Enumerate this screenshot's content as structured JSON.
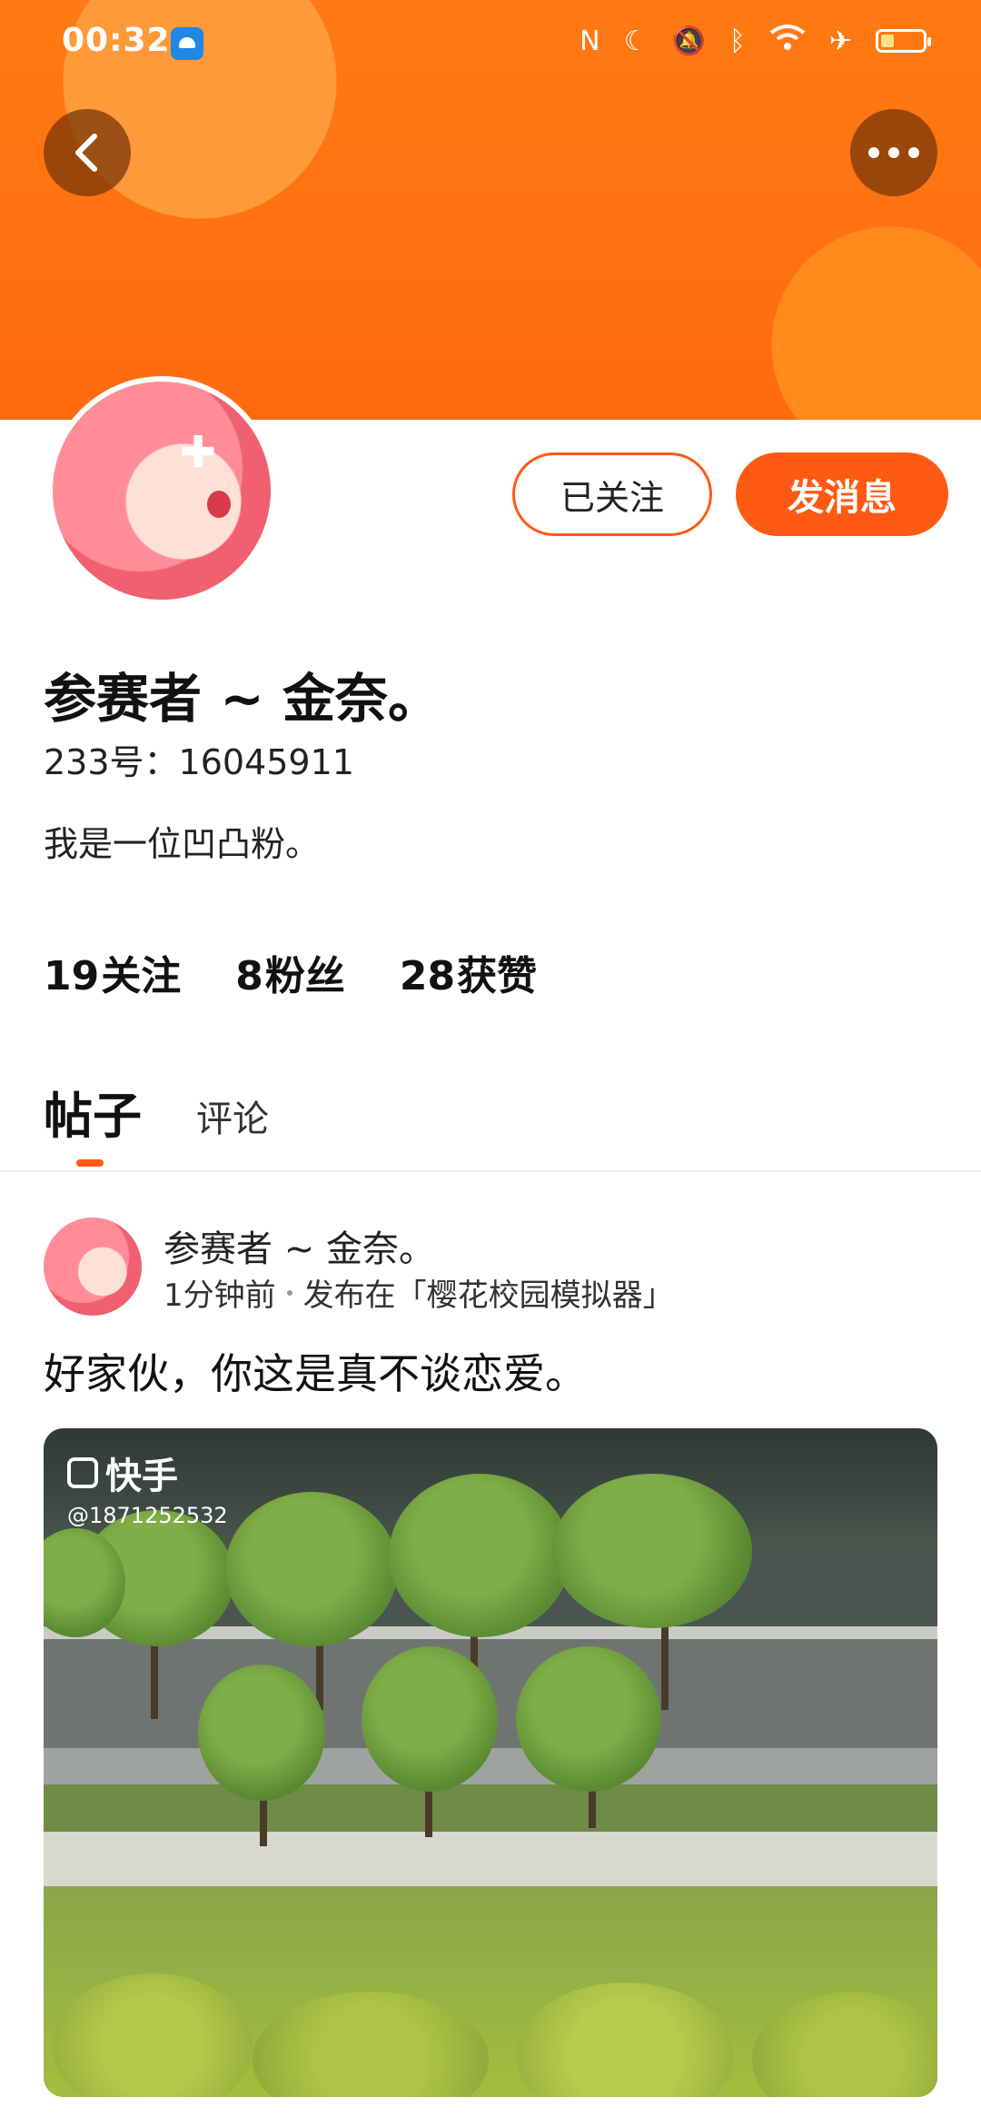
{
  "status_bar": {
    "time": "00:32",
    "icons": [
      "nfc-icon",
      "moon-icon",
      "mute-icon",
      "bluetooth-icon",
      "wifi-icon",
      "airplane-icon",
      "battery-icon"
    ]
  },
  "header": {
    "back_icon": "chevron-left-icon",
    "more_icon": "more-dots-icon"
  },
  "profile": {
    "nickname": "参赛者 ~ 金奈。",
    "uid": "233号：16045911",
    "bio": "我是一位凹凸粉。",
    "followed_label": "已关注",
    "message_label": "发消息"
  },
  "stats": [
    {
      "num": "19",
      "label": "关注"
    },
    {
      "num": "8",
      "label": "粉丝"
    },
    {
      "num": "28",
      "label": "获赞"
    }
  ],
  "tabs": [
    {
      "label": "帖子",
      "active": true
    },
    {
      "label": "评论",
      "active": false
    }
  ],
  "post": {
    "author": "参赛者 ~ 金奈。",
    "time": "1分钟前",
    "published_in": "发布在「樱花校园模拟器」",
    "text": "好家伙，你这是真不谈恋爱。",
    "video_watermark": "快手",
    "video_user": "@1871252532"
  },
  "colors": {
    "accent": "#ff5a14",
    "banner": "#ff7a12"
  }
}
